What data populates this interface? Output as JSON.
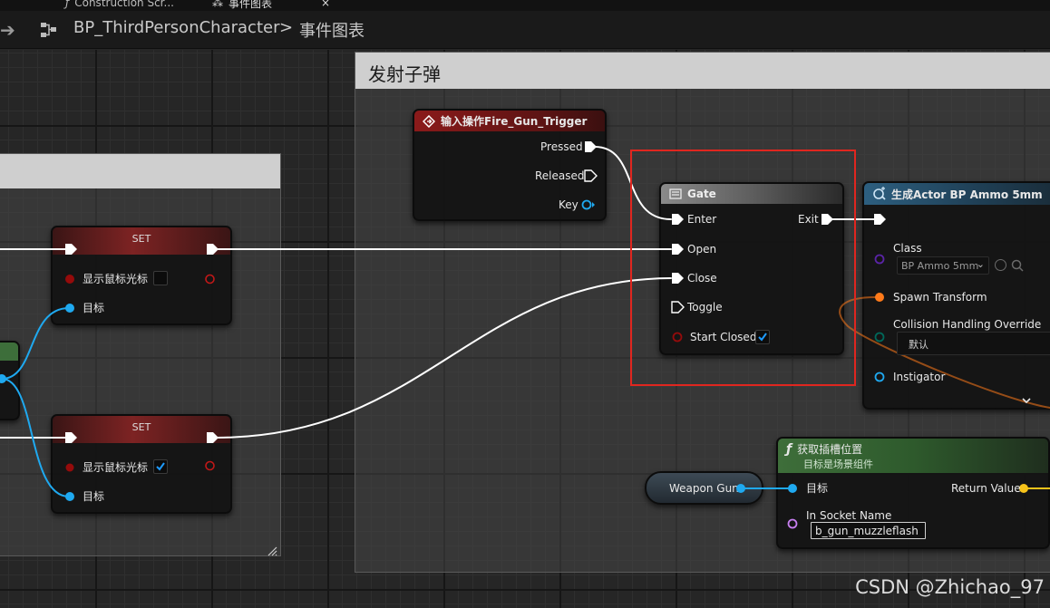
{
  "tabs": [
    {
      "label": "Construction Scr..."
    },
    {
      "label": "事件图表"
    }
  ],
  "breadcrumb": {
    "root": "BP_ThirdPersonCharacter",
    "separator": ">",
    "current": "事件图表"
  },
  "comment": {
    "title": "发射子弹"
  },
  "input_event": {
    "title": "输入操作Fire_Gun_Trigger",
    "pins": {
      "pressed": "Pressed",
      "released": "Released",
      "key": "Key"
    }
  },
  "gate": {
    "title": "Gate",
    "pins": {
      "enter": "Enter",
      "exit": "Exit",
      "open": "Open",
      "close": "Close",
      "toggle": "Toggle",
      "start_closed": "Start Closed"
    },
    "start_closed_value": true
  },
  "set_nodes": [
    {
      "title": "SET",
      "var_label": "显示鼠标光标",
      "target_label": "目标",
      "checked": false
    },
    {
      "title": "SET",
      "var_label": "显示鼠标光标",
      "target_label": "目标",
      "checked": true
    }
  ],
  "spawn": {
    "title": "生成Actor BP Ammo 5mm",
    "class_label": "Class",
    "class_value": "BP Ammo 5mm",
    "spawn_transform": "Spawn Transform",
    "collision_label": "Collision Handling Override",
    "collision_value": "默认",
    "instigator": "Instigator"
  },
  "socket": {
    "title": "获取插槽位置",
    "subtitle": "目标是场景组件",
    "target": "目标",
    "return_value": "Return Value",
    "socket_name_label": "In Socket Name",
    "socket_name_value": "b_gun_muzzleflash"
  },
  "weapon_var": {
    "label": "Weapon Gun"
  },
  "watermark": "CSDN @Zhichao_97",
  "colors": {
    "exec": "#ffffff",
    "object_pin": "#1fa9f0",
    "bool_pin": "#950b0b",
    "struct_pin": "#ff7a1a",
    "vector_pin": "#f7c31a",
    "name_pin": "#c77ff0",
    "class_pin": "#5a24a6",
    "enum_pin": "#00685a",
    "highlight": "#e0261f"
  }
}
